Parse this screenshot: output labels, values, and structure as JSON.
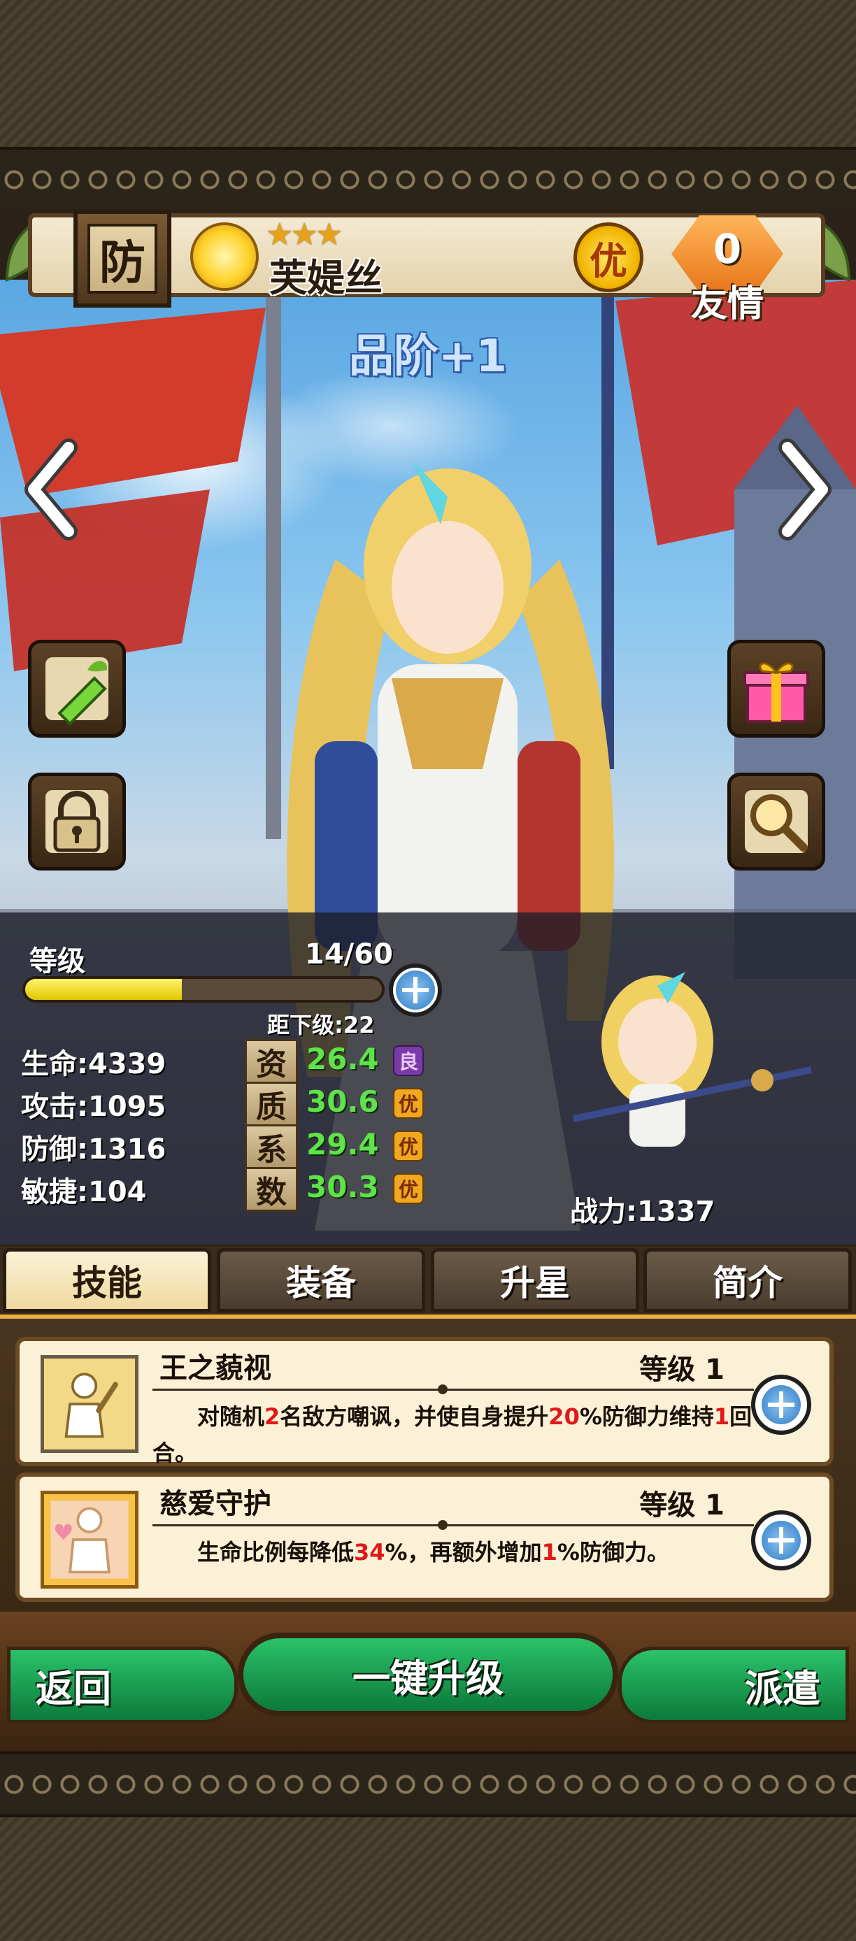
{
  "header": {
    "class_badge": "防",
    "stars": "★★★",
    "hero_name": "芙媞丝",
    "quality": "优",
    "friendship_count": "0",
    "friendship_label": "友情"
  },
  "rank_text": "品阶+1",
  "level": {
    "label": "等级",
    "value": "14/60",
    "progress": 0.44,
    "to_next": "距下级:22"
  },
  "stats": [
    {
      "label": "生命:4339"
    },
    {
      "label": "攻击:1095"
    },
    {
      "label": "防御:1316"
    },
    {
      "label": "敏捷:104"
    }
  ],
  "aptitude": [
    {
      "char": "资",
      "value": "26.4",
      "grade": "良",
      "grade_color": "purple"
    },
    {
      "char": "质",
      "value": "30.6",
      "grade": "优",
      "grade_color": "gold"
    },
    {
      "char": "系",
      "value": "29.4",
      "grade": "优",
      "grade_color": "gold"
    },
    {
      "char": "数",
      "value": "30.3",
      "grade": "优",
      "grade_color": "gold"
    }
  ],
  "power": "战力:1337",
  "tabs": [
    "技能",
    "装备",
    "升星",
    "简介"
  ],
  "active_tab": 0,
  "skills": [
    {
      "name": "王之藐视",
      "level": "等级 1",
      "desc_parts": [
        "对随机",
        "2",
        "名敌方嘲讽，并使自身提升",
        "20",
        "%防御力维持",
        "1",
        "回合。"
      ]
    },
    {
      "name": "慈爱守护",
      "level": "等级 1",
      "desc_parts": [
        "生命比例每降低",
        "34",
        "%，再额外增加",
        "1",
        "%防御力。"
      ]
    }
  ],
  "actions": {
    "back": "返回",
    "upgrade_all": "一键升级",
    "dispatch": "派遣"
  },
  "icons": {
    "left_arrow": "chevron-left-icon",
    "right_arrow": "chevron-right-icon",
    "potion": "potion-icon",
    "gift": "gift-icon",
    "lock": "lock-icon",
    "search": "magnifier-icon",
    "plus": "plus-icon"
  },
  "colors": {
    "accent_green": "#5fe24a",
    "highlight_red": "#e01818",
    "quality_gold": "#f0a820"
  }
}
